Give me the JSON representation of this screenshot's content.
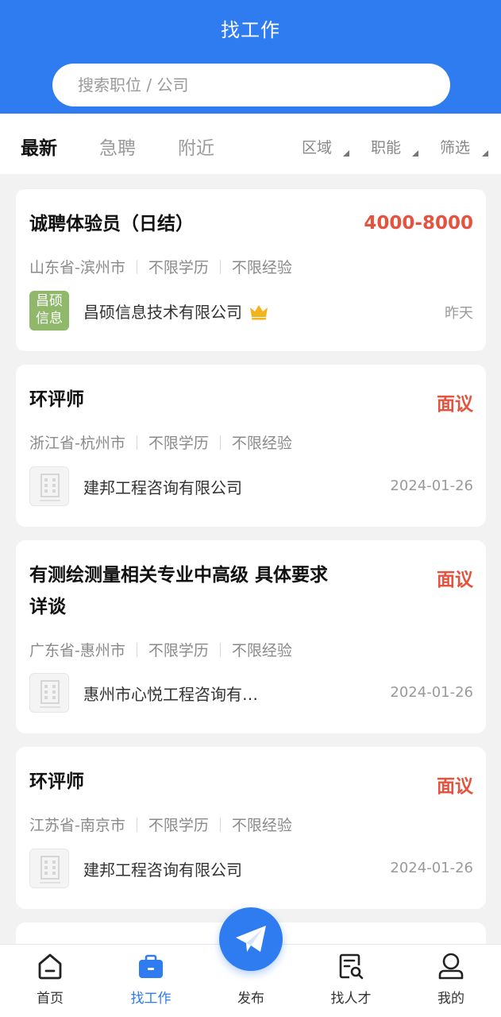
{
  "header": {
    "title": "找工作"
  },
  "search": {
    "placeholder": "搜索职位 / 公司"
  },
  "tabs": [
    {
      "label": "最新",
      "active": true
    },
    {
      "label": "急聘",
      "active": false
    },
    {
      "label": "附近",
      "active": false
    }
  ],
  "filters": [
    {
      "label": "区域"
    },
    {
      "label": "职能"
    },
    {
      "label": "筛选"
    }
  ],
  "jobs": [
    {
      "title": "诚聘体验员（日结）",
      "salary": "4000-8000",
      "location": "山东省-滨州市",
      "education": "不限学历",
      "experience": "不限经验",
      "company": "昌硕信息技术有限公司",
      "logo_text_top": "昌硕",
      "logo_text_bottom": "信息",
      "verified": true,
      "date": "昨天"
    },
    {
      "title": "环评师",
      "salary": "面议",
      "location": "浙江省-杭州市",
      "education": "不限学历",
      "experience": "不限经验",
      "company": "建邦工程咨询有限公司",
      "date": "2024-01-26"
    },
    {
      "title": "有测绘测量相关专业中高级 具体要求详谈",
      "salary": "面议",
      "location": "广东省-惠州市",
      "education": "不限学历",
      "experience": "不限经验",
      "company": "惠州市心悦工程咨询有…",
      "date": "2024-01-26"
    },
    {
      "title": "环评师",
      "salary": "面议",
      "location": "江苏省-南京市",
      "education": "不限学历",
      "experience": "不限经验",
      "company": "建邦工程咨询有限公司",
      "date": "2024-01-26"
    }
  ],
  "nav": [
    {
      "label": "首页",
      "icon": "home-icon",
      "active": false
    },
    {
      "label": "找工作",
      "icon": "briefcase-icon",
      "active": true
    },
    {
      "label": "发布",
      "icon": "paper-plane-icon",
      "active": false
    },
    {
      "label": "找人才",
      "icon": "talent-search-icon",
      "active": false
    },
    {
      "label": "我的",
      "icon": "user-icon",
      "active": false
    }
  ],
  "colors": {
    "primary": "#2f7bf0",
    "salary": "#e5533f",
    "background": "#f2f2f2",
    "logo_green": "#8fb86a",
    "crown": "#f3b31c"
  }
}
